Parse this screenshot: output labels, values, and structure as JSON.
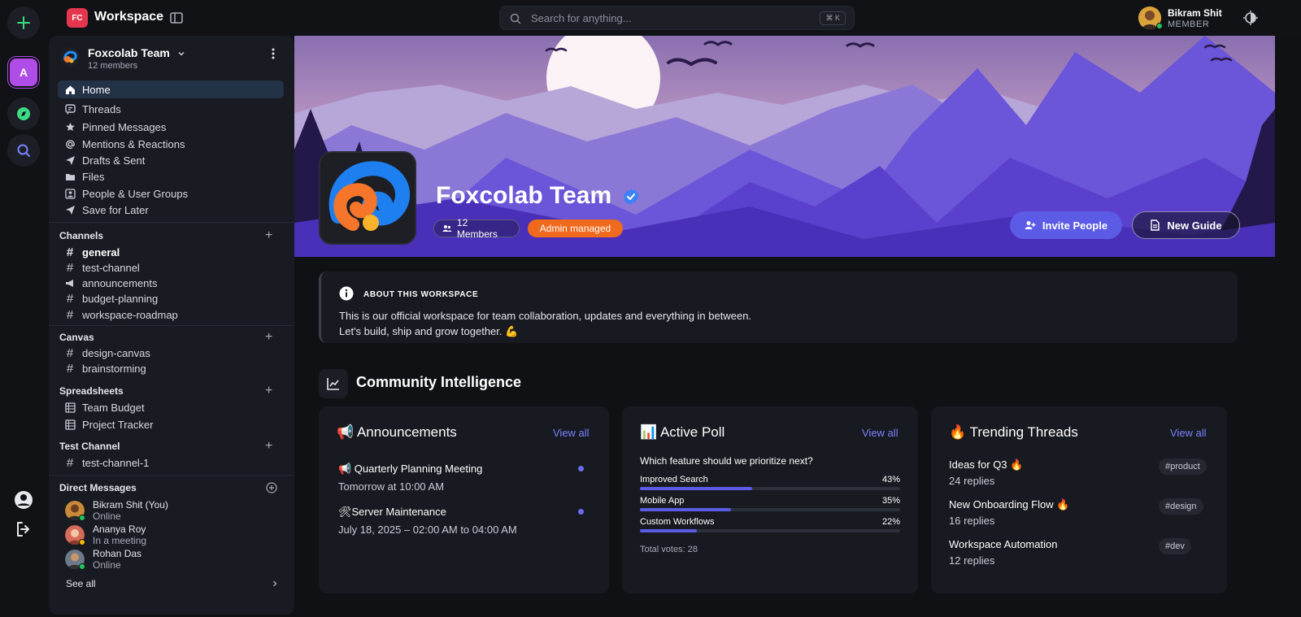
{
  "topbar": {
    "logo_badge": "FC",
    "brand": "Workspace",
    "search_placeholder": "Search for anything...",
    "search_shortcut": "⌘ K",
    "user_name": "Bikram Shit",
    "user_role": "MEMBER"
  },
  "rail": {
    "workspace_letter": "A"
  },
  "sidebar": {
    "team_name": "Foxcolab Team",
    "team_members": "12 members",
    "nav": [
      {
        "label": "Home",
        "icon": "home-icon"
      },
      {
        "label": "Threads",
        "icon": "threads-icon"
      },
      {
        "label": "Pinned Messages",
        "icon": "star-icon"
      },
      {
        "label": "Mentions & Reactions",
        "icon": "at-icon"
      },
      {
        "label": "Drafts & Sent",
        "icon": "send-icon"
      },
      {
        "label": "Files",
        "icon": "folder-icon"
      },
      {
        "label": "People & User Groups",
        "icon": "people-icon"
      },
      {
        "label": "Save for Later",
        "icon": "bookmark-icon"
      }
    ],
    "sections": {
      "channels": {
        "title": "Channels",
        "items": [
          "general",
          "test-channel",
          "announcements",
          "budget-planning",
          "workspace-roadmap"
        ]
      },
      "canvas": {
        "title": "Canvas",
        "items": [
          "design-canvas",
          "brainstorming"
        ]
      },
      "spreadsheets": {
        "title": "Spreadsheets",
        "items": [
          "Team Budget",
          "Project Tracker"
        ]
      },
      "test_channel": {
        "title": "Test Channel",
        "items": [
          "test-channel-1"
        ]
      },
      "direct_messages": {
        "title": "Direct Messages",
        "items": [
          {
            "name": "Bikram Shit (You)",
            "status": "Online",
            "status_color": "#22c55e"
          },
          {
            "name": "Ananya Roy",
            "status": "In a meeting",
            "status_color": "#f5b400"
          },
          {
            "name": "Rohan Das",
            "status": "Online",
            "status_color": "#22c55e"
          }
        ],
        "see_all": "See all"
      }
    }
  },
  "banner": {
    "title": "Foxcolab Team",
    "members_pill": "12 Members",
    "admin_pill": "Admin managed",
    "invite_button": "Invite People",
    "guide_button": "New Guide"
  },
  "about": {
    "title": "ABOUT THIS WORKSPACE",
    "line1": "This is our official workspace for team collaboration, updates and everything in between.",
    "line2": "Let's build, ship and grow together. 💪"
  },
  "community": {
    "title": "Community Intelligence",
    "announcements": {
      "title": "📢 Announcements",
      "view_all": "View all",
      "items": [
        {
          "title": "📢 Quarterly Planning Meeting",
          "sub": "Tomorrow at 10:00 AM"
        },
        {
          "title": "🛠Server Maintenance",
          "sub": "July 18, 2025 – 02:00 AM to 04:00 AM"
        }
      ]
    },
    "poll": {
      "title": "📊 Active Poll",
      "view_all": "View all",
      "question": "Which feature should we prioritize next?",
      "options": [
        {
          "label": "Improved Search",
          "pct": "43%",
          "value": 43
        },
        {
          "label": "Mobile App",
          "pct": "35%",
          "value": 35
        },
        {
          "label": "Custom Workflows",
          "pct": "22%",
          "value": 22
        }
      ],
      "total": "Total votes: 28"
    },
    "trending": {
      "title": "🔥 Trending Threads",
      "view_all": "View all",
      "items": [
        {
          "title": "Ideas for Q3 🔥",
          "sub": "24 replies",
          "tag": "#product"
        },
        {
          "title": "New Onboarding Flow 🔥",
          "sub": "16 replies",
          "tag": "#design"
        },
        {
          "title": "Workspace Automation",
          "sub": "12 replies",
          "tag": "#dev"
        }
      ]
    }
  },
  "colors": {
    "accent": "#5b5be6",
    "admin_pill": "#f06a1d",
    "link": "#7c82ff",
    "online": "#22c55e",
    "away": "#f5b400"
  }
}
